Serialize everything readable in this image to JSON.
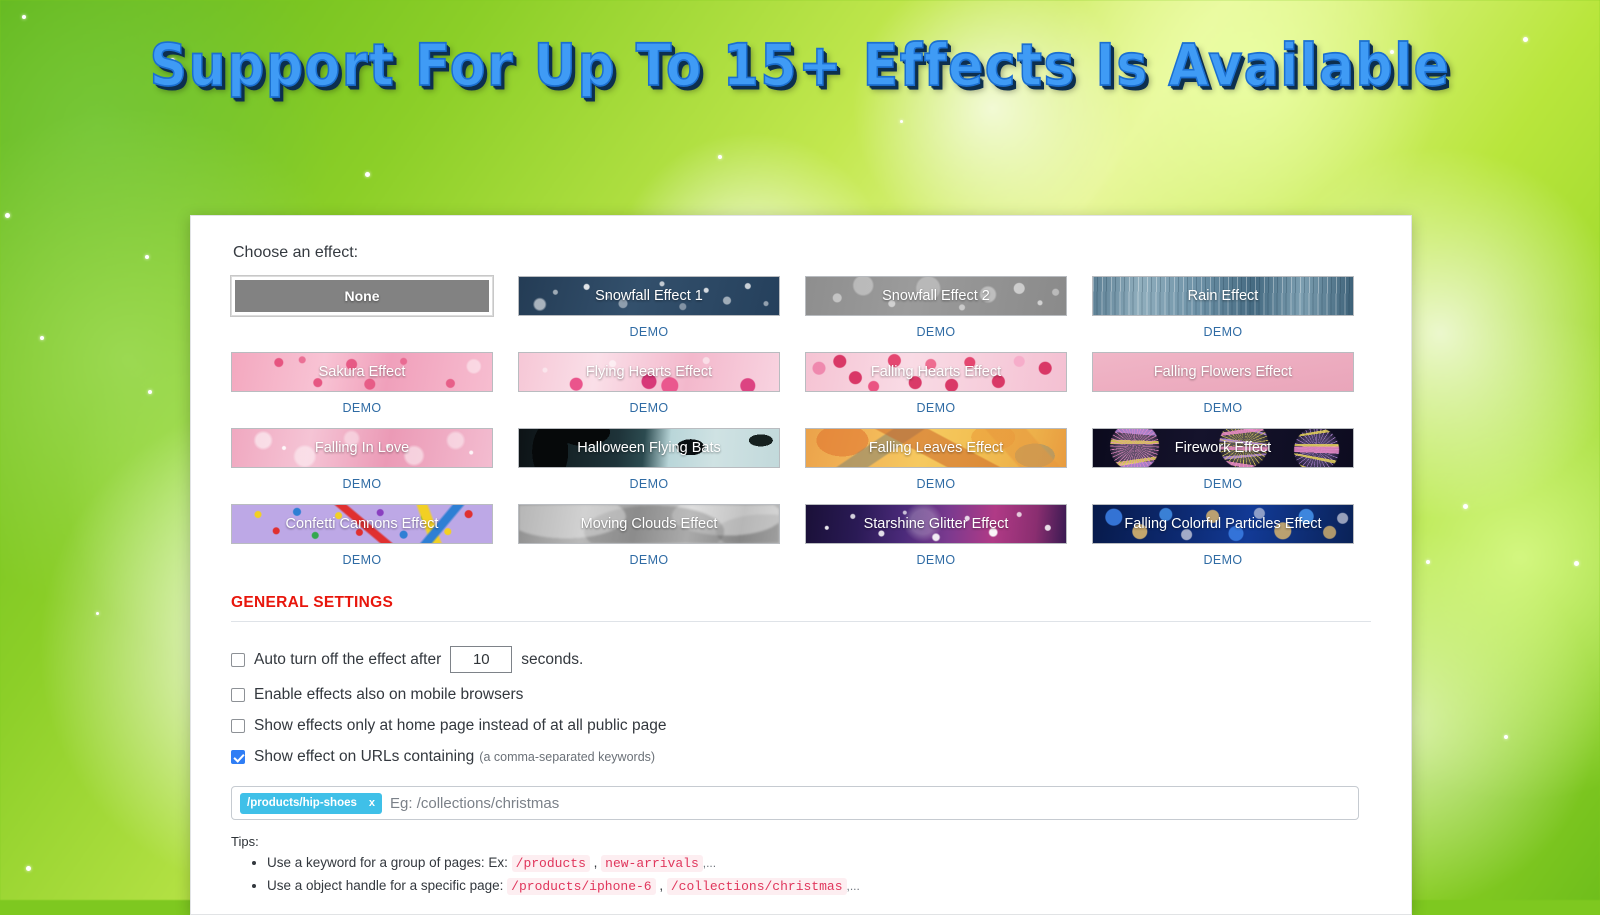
{
  "title": "Support For Up To 15+ Effects Is Available",
  "panel": {
    "choose_label": "Choose an effect:",
    "demo_label": "DEMO",
    "effects": [
      {
        "label": "None",
        "art": "a-none",
        "selected": true,
        "has_demo": false
      },
      {
        "label": "Snowfall Effect 1",
        "art": "a-snow1",
        "selected": false,
        "has_demo": true
      },
      {
        "label": "Snowfall Effect 2",
        "art": "a-snow2",
        "selected": false,
        "has_demo": true
      },
      {
        "label": "Rain Effect",
        "art": "a-rain",
        "selected": false,
        "has_demo": true
      },
      {
        "label": "Sakura Effect",
        "art": "a-sakura",
        "selected": false,
        "has_demo": true
      },
      {
        "label": "Flying Hearts Effect",
        "art": "a-flyhearts",
        "selected": false,
        "has_demo": true
      },
      {
        "label": "Falling Hearts Effect",
        "art": "a-fallhearts",
        "selected": false,
        "has_demo": true
      },
      {
        "label": "Falling Flowers Effect",
        "art": "a-fallflowers",
        "selected": false,
        "has_demo": true
      },
      {
        "label": "Falling In Love",
        "art": "a-fallinlove",
        "selected": false,
        "has_demo": true
      },
      {
        "label": "Halloween Flying Bats",
        "art": "a-bats",
        "selected": false,
        "has_demo": true
      },
      {
        "label": "Falling Leaves Effect",
        "art": "a-leaves",
        "selected": false,
        "has_demo": true
      },
      {
        "label": "Firework Effect",
        "art": "a-firework",
        "selected": false,
        "has_demo": true
      },
      {
        "label": "Confetti Cannons Effect",
        "art": "a-confetti",
        "selected": false,
        "has_demo": true
      },
      {
        "label": "Moving Clouds Effect",
        "art": "a-clouds",
        "selected": false,
        "has_demo": true
      },
      {
        "label": "Starshine Glitter Effect",
        "art": "a-starshine",
        "selected": false,
        "has_demo": true
      },
      {
        "label": "Falling Colorful Particles Effect",
        "art": "a-particles",
        "selected": false,
        "has_demo": true
      }
    ]
  },
  "general_settings": {
    "heading": "GENERAL SETTINGS",
    "auto_off_prefix": "Auto turn off the effect after",
    "auto_off_value": "10",
    "auto_off_suffix": "seconds.",
    "auto_off_checked": false,
    "mobile_label": "Enable effects also on mobile browsers",
    "mobile_checked": false,
    "home_only_label": "Show effects only at home page instead of at all public page",
    "home_only_checked": false,
    "urls_label": "Show effect on URLs containing",
    "urls_hint": "(a comma-separated keywords)",
    "urls_checked": true
  },
  "url_field": {
    "tags": [
      {
        "text": "/products/hip-shoes",
        "remove": "x"
      }
    ],
    "placeholder": "Eg: /collections/christmas"
  },
  "tips": {
    "title": "Tips",
    "title_colon": ":",
    "items": [
      {
        "text": "Use a keyword for a group of pages: Ex:",
        "codes": [
          "/products",
          "new-arrivals"
        ],
        "sep": ",",
        "ellipsis": ",..."
      },
      {
        "text": "Use a object handle for a specific page:",
        "codes": [
          "/products/iphone-6",
          "/collections/christmas"
        ],
        "sep": ",",
        "ellipsis": ",..."
      }
    ]
  },
  "colors": {
    "accent_red": "#e8160c",
    "demo_link": "#2f6ba4",
    "tag_bg": "#3fc0e8",
    "checkbox_checked": "#2f7ef5",
    "title_fill": "#3f9bf5",
    "code_fg": "#e0365c"
  }
}
